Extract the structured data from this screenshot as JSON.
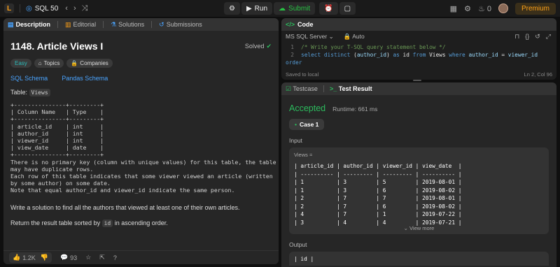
{
  "nav": {
    "list_name": "SQL 50",
    "run_label": "Run",
    "submit_label": "Submit",
    "streak": "0",
    "premium_label": "Premium"
  },
  "left": {
    "tabs": [
      "Description",
      "Editorial",
      "Solutions",
      "Submissions"
    ],
    "title": "1148. Article Views I",
    "status": "Solved",
    "chips": [
      "Easy",
      "Topics",
      "Companies"
    ],
    "links": [
      "SQL Schema",
      "Pandas Schema"
    ],
    "table_label": "Table:",
    "table_name": "Views",
    "schema_text": "+---------------+---------+\n| Column Name   | Type    |\n+---------------+---------+\n| article_id    | int     |\n| author_id     | int     |\n| viewer_id     | int     |\n| view_date     | date    |\n+---------------+---------+\nThere is no primary key (column with unique values) for this table, the table\nmay have duplicate rows.\nEach row of this table indicates that some viewer viewed an article (written\nby some author) on some date.\nNote that equal author_id and viewer_id indicate the same person.",
    "task": "Write a solution to find all the authors that viewed at least one of their own articles.",
    "order_pre": "Return the result table sorted by",
    "order_code": "id",
    "order_post": "in ascending order.",
    "likes": "1.2K",
    "comments": "93"
  },
  "code": {
    "header": "Code",
    "language": "MS SQL Server",
    "mode": "Auto",
    "line1_num": "1",
    "line1": "/* Write your T-SQL query statement below */",
    "line2_num": "2",
    "saved": "Saved to local",
    "position": "Ln 2, Col 96"
  },
  "result": {
    "tab_testcase": "Testcase",
    "tab_result": "Test Result",
    "status": "Accepted",
    "runtime": "Runtime: 661 ms",
    "case_label": "Case 1",
    "input_label": "Input",
    "views_label": "Views =",
    "views_table": "| article_id | author_id | viewer_id | view_date  |\n| ---------- | --------- | --------- | ---------- |\n| 1          | 3         | 5         | 2019-08-01 |\n| 1          | 3         | 6         | 2019-08-02 |\n| 2          | 7         | 7         | 2019-08-01 |\n| 2          | 7         | 6         | 2019-08-02 |\n| 4          | 7         | 1         | 2019-07-22 |\n| 3          | 4         | 4         | 2019-07-21 |",
    "view_more": "View more",
    "output_label": "Output",
    "output_text": "| id |"
  },
  "colors": {
    "accent": "#ffa116",
    "success": "#2cbb5d",
    "link": "#4aa4ff"
  }
}
